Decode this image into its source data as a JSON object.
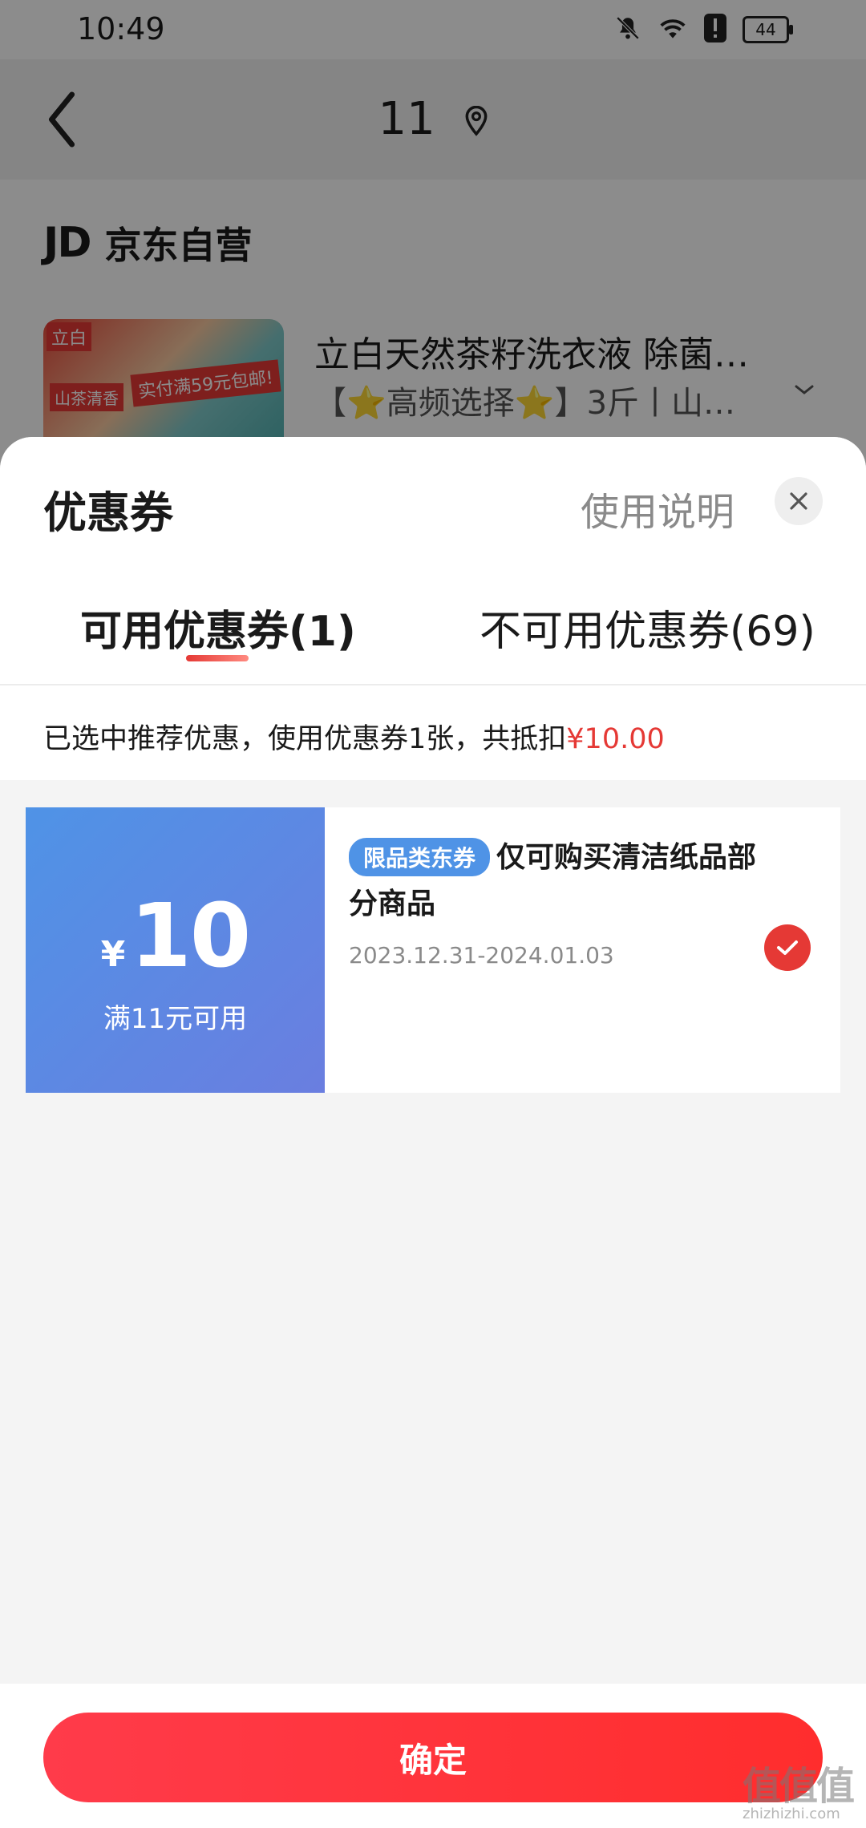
{
  "status_bar": {
    "time": "10:49",
    "battery": "44"
  },
  "topbar": {
    "address": "11"
  },
  "shop": {
    "logo": "JD",
    "name": "京东自营"
  },
  "product": {
    "title": "立白天然茶籽洗衣液 除菌…",
    "subtitle": "【⭐高频选择⭐】3斤丨山…",
    "image_tags": [
      "立白",
      "实付满59元包邮!",
      "山茶清香"
    ]
  },
  "sheet": {
    "title": "优惠券",
    "help_label": "使用说明",
    "tabs": [
      {
        "label": "可用优惠券(1)",
        "active": true
      },
      {
        "label": "不可用优惠券(69)",
        "active": false
      }
    ],
    "summary_prefix": "已选中推荐优惠，使用优惠券1张，共抵扣",
    "summary_amount": "¥10.00"
  },
  "coupons": [
    {
      "currency": "¥",
      "amount": "10",
      "condition": "满11元可用",
      "badge": "限品类东券",
      "description": "仅可购买清洁纸品部分商品",
      "validity": "2023.12.31-2024.01.03",
      "selected": true
    }
  ],
  "footer": {
    "confirm_label": "确定"
  },
  "watermark": {
    "main": "值值值",
    "sub": "zhizhizhi.com"
  },
  "colors": {
    "accent_red": "#e53935",
    "coupon_blue": "#4f93e6",
    "coupon_purple": "#6a7ee0"
  },
  "icons": [
    "back-icon",
    "location-pin-icon",
    "mute-bell-icon",
    "wifi-icon",
    "alert-icon",
    "battery-icon",
    "chevron-down-icon",
    "close-icon",
    "check-icon"
  ]
}
